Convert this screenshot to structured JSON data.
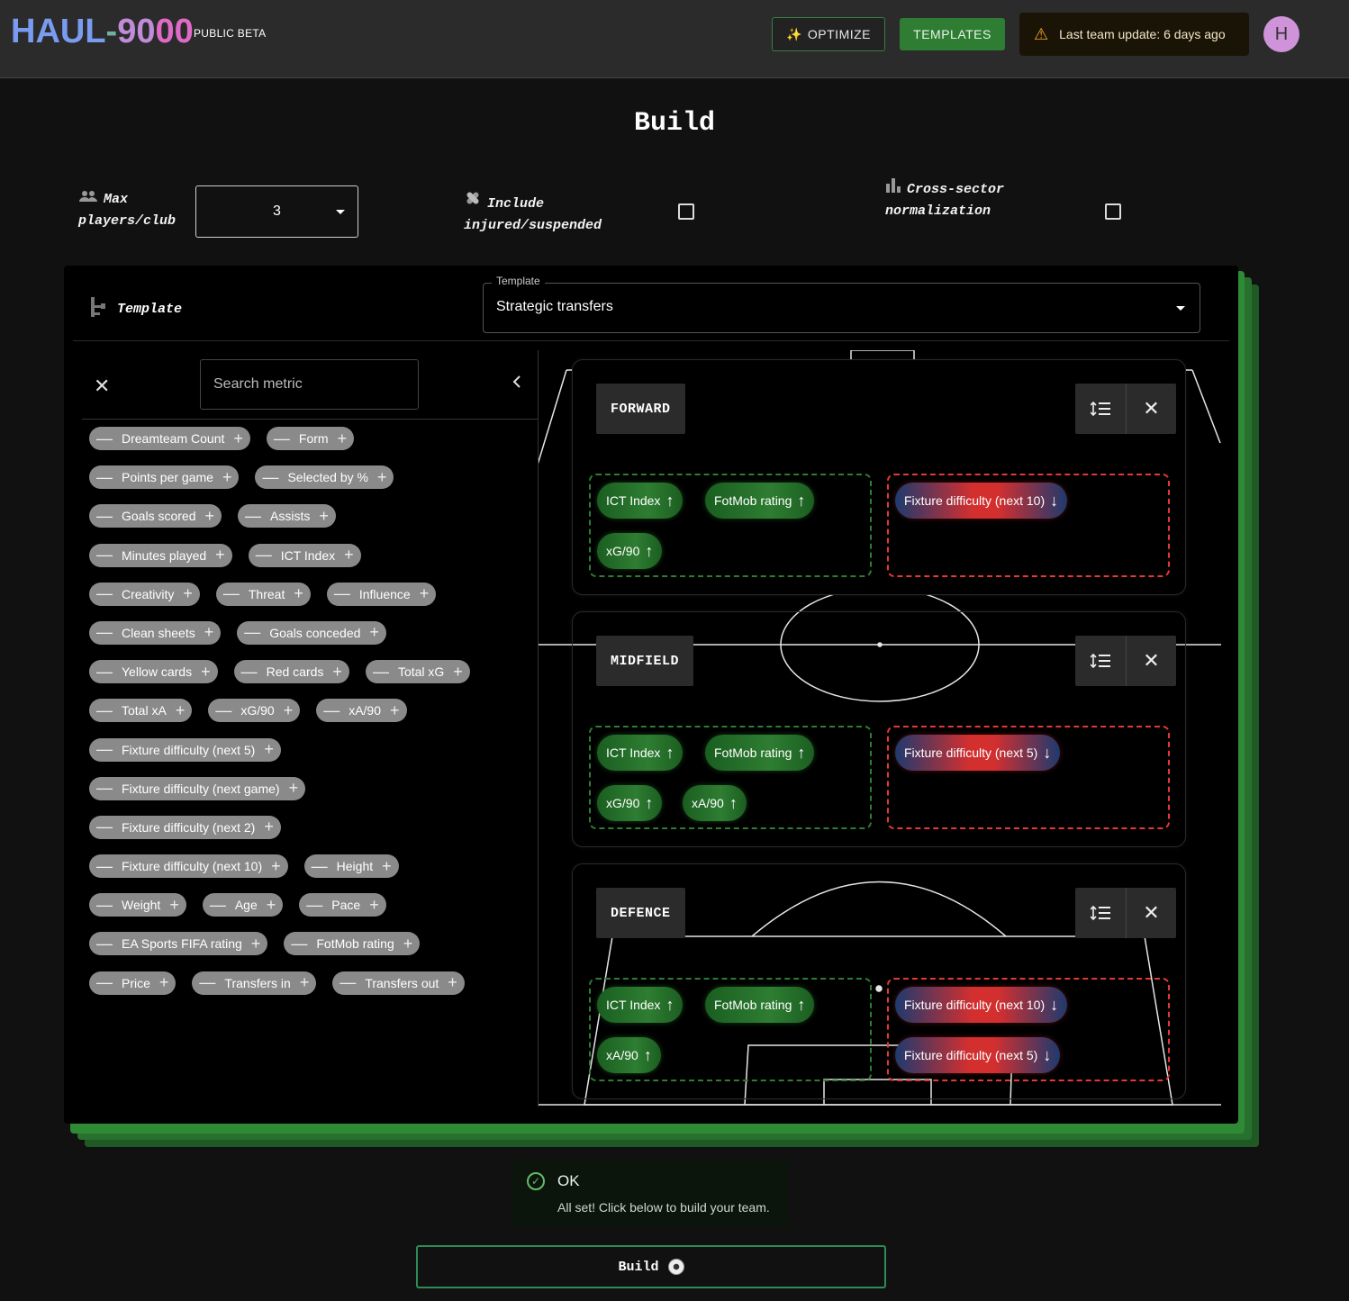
{
  "header": {
    "logo_part1": "HAUL",
    "logo_part2": "-",
    "logo_part3": "90",
    "logo_part4": "00",
    "beta_label": "PUBLIC BETA",
    "optimize_label": "OPTIMIZE",
    "optimize_icon": "✨",
    "templates_label": "TEMPLATES",
    "update_text": "Last team update: 6 days ago",
    "avatar_letter": "H"
  },
  "page_title": "Build",
  "options": {
    "max_players_label": "Max players/club",
    "max_players_value": "3",
    "injured_label": "Include injured/suspended",
    "cross_sector_label": "Cross-sector normalization"
  },
  "template": {
    "label": "Template",
    "field_legend": "Template",
    "selected": "Strategic transfers"
  },
  "metrics_panel": {
    "search_placeholder": "Search metric",
    "chip_rows": [
      [
        "Dreamteam Count",
        "Form"
      ],
      [
        "Points per game",
        "Selected by %"
      ],
      [
        "Goals scored",
        "Assists"
      ],
      [
        "Minutes played",
        "ICT Index"
      ],
      [
        "Creativity",
        "Threat",
        "Influence"
      ],
      [
        "Clean sheets",
        "Goals conceded"
      ],
      [
        "Yellow cards",
        "Red cards",
        "Total xG"
      ],
      [
        "Total xA",
        "xG/90",
        "xA/90"
      ],
      [
        "Fixture difficulty (next 5)"
      ],
      [
        "Fixture difficulty (next game)"
      ],
      [
        "Fixture difficulty (next 2)"
      ],
      [
        "Fixture difficulty (next 10)",
        "Height"
      ],
      [
        "Weight",
        "Age",
        "Pace"
      ],
      [
        "EA Sports FIFA rating",
        "FotMob rating"
      ],
      [
        "Price",
        "Transfers in",
        "Transfers out"
      ]
    ]
  },
  "positions": {
    "forward": {
      "label": "FORWARD",
      "up": [
        "ICT Index",
        "FotMob rating",
        "xG/90"
      ],
      "down": [
        "Fixture difficulty (next 10)"
      ]
    },
    "midfield": {
      "label": "MIDFIELD",
      "up": [
        "ICT Index",
        "FotMob rating",
        "xG/90",
        "xA/90"
      ],
      "down": [
        "Fixture difficulty (next 5)"
      ]
    },
    "defence": {
      "label": "DEFENCE",
      "up": [
        "ICT Index",
        "FotMob rating",
        "xA/90"
      ],
      "down": [
        "Fixture difficulty (next 10)",
        "Fixture difficulty (next 5)"
      ]
    }
  },
  "status": {
    "title": "OK",
    "message": "All set! Click below to build your team."
  },
  "build_button_label": "Build",
  "colors": {
    "accent_green": "#2e7d32",
    "warning": "#f5a623",
    "avatar": "#ce93d8",
    "down_red": "#e53935"
  }
}
